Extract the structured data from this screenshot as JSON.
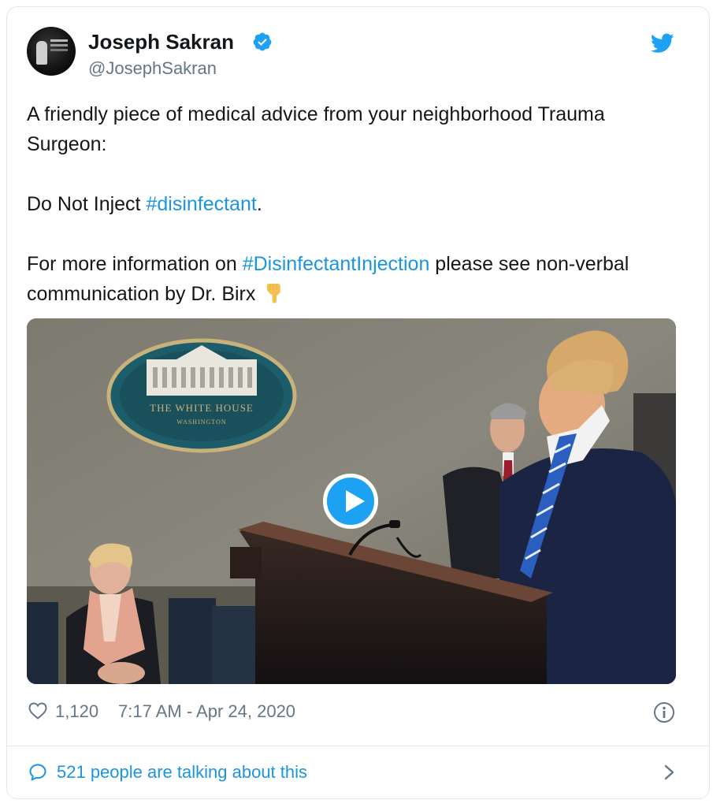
{
  "author": {
    "display_name": "Joseph Sakran",
    "handle": "@JosephSakran",
    "verified_icon": "verified-badge-icon",
    "avatar_icon": "avatar"
  },
  "brand": {
    "icon": "twitter-bird-icon",
    "color": "#1da1f2"
  },
  "tweet": {
    "line1": "A friendly piece of medical advice from your neighborhood Trauma Surgeon:",
    "p2_prefix": "Do Not Inject ",
    "p2_hashtag": "#disinfectant",
    "p2_suffix": ".",
    "p3_prefix": "For more information on ",
    "p3_hashtag": "#DisinfectantInjection",
    "p3_suffix": " please see non-verbal communication by Dr. Birx",
    "emoji": "backhand-index-pointing-down"
  },
  "media": {
    "type": "video",
    "seal_text": "THE WHITE HOUSE",
    "seal_subtext": "WASHINGTON",
    "play_icon": "play-icon"
  },
  "meta": {
    "like_count": "1,120",
    "timestamp": "7:17 AM - Apr 24, 2020"
  },
  "footer": {
    "talking_label": "521 people are talking about this"
  },
  "colors": {
    "link": "#1b95e0",
    "text": "#14171a",
    "secondary": "#657786",
    "border": "#e1e8ed"
  }
}
